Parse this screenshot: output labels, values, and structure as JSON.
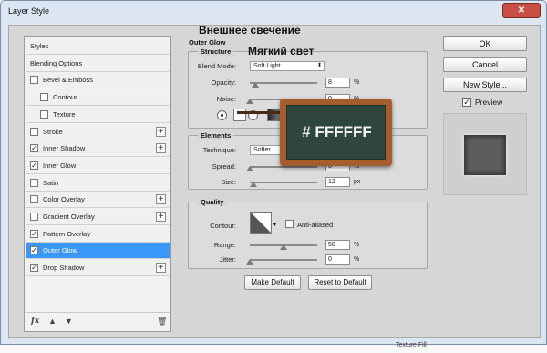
{
  "window": {
    "title": "Layer Style"
  },
  "styles_list": {
    "items": [
      {
        "label": "Styles",
        "checkbox": false,
        "checked": false,
        "indent": false,
        "plus": false,
        "selected": false
      },
      {
        "label": "Blending Options",
        "checkbox": false,
        "checked": false,
        "indent": false,
        "plus": false,
        "selected": false
      },
      {
        "label": "Bevel & Emboss",
        "checkbox": true,
        "checked": false,
        "indent": false,
        "plus": false,
        "selected": false
      },
      {
        "label": "Contour",
        "checkbox": true,
        "checked": false,
        "indent": true,
        "plus": false,
        "selected": false
      },
      {
        "label": "Texture",
        "checkbox": true,
        "checked": false,
        "indent": true,
        "plus": false,
        "selected": false
      },
      {
        "label": "Stroke",
        "checkbox": true,
        "checked": false,
        "indent": false,
        "plus": true,
        "selected": false
      },
      {
        "label": "Inner Shadow",
        "checkbox": true,
        "checked": true,
        "indent": false,
        "plus": true,
        "selected": false
      },
      {
        "label": "Inner Glow",
        "checkbox": true,
        "checked": true,
        "indent": false,
        "plus": false,
        "selected": false
      },
      {
        "label": "Satin",
        "checkbox": true,
        "checked": false,
        "indent": false,
        "plus": false,
        "selected": false
      },
      {
        "label": "Color Overlay",
        "checkbox": true,
        "checked": false,
        "indent": false,
        "plus": true,
        "selected": false
      },
      {
        "label": "Gradient Overlay",
        "checkbox": true,
        "checked": false,
        "indent": false,
        "plus": true,
        "selected": false
      },
      {
        "label": "Pattern Overlay",
        "checkbox": true,
        "checked": true,
        "indent": false,
        "plus": false,
        "selected": false
      },
      {
        "label": "Outer Glow",
        "checkbox": true,
        "checked": true,
        "indent": false,
        "plus": false,
        "selected": true
      },
      {
        "label": "Drop Shadow",
        "checkbox": true,
        "checked": true,
        "indent": false,
        "plus": true,
        "selected": false
      }
    ],
    "footer_icons": [
      "fx-icon",
      "move-up-icon",
      "move-down-icon",
      "trash-icon"
    ],
    "fx_label": "fx"
  },
  "outer_glow": {
    "header": "Outer Glow",
    "structure_title": "Structure",
    "blend_mode_label": "Blend Mode:",
    "blend_mode_value": "Soft Light",
    "opacity_label": "Opacity:",
    "opacity_value": "8",
    "opacity_fraction": 0.08,
    "noise_label": "Noise:",
    "noise_value": "0",
    "noise_fraction": 0.0,
    "elements_title": "Elements",
    "technique_label": "Technique:",
    "technique_value": "Softer",
    "spread_label": "Spread:",
    "spread_value": "0",
    "spread_fraction": 0.0,
    "size_label": "Size:",
    "size_value": "12",
    "size_fraction": 0.05,
    "quality_title": "Quality",
    "contour_label": "Contour:",
    "anti_aliased_label": "Anti-aliased",
    "range_label": "Range:",
    "range_value": "50",
    "range_fraction": 0.5,
    "jitter_label": "Jitter:",
    "jitter_value": "0",
    "jitter_fraction": 0.0,
    "percent_unit": "%",
    "px_unit": "px",
    "make_default_label": "Make Default",
    "reset_default_label": "Reset to Default"
  },
  "right_panel": {
    "ok_label": "OK",
    "cancel_label": "Cancel",
    "new_style_label": "New Style...",
    "preview_label": "Preview",
    "preview_checked": true
  },
  "annotations": {
    "outer_glow_ru": "Внешнее свечение",
    "soft_light_ru": "Мягкий свет",
    "color_sign": "# FFFFFF"
  },
  "colors": {
    "selected_row": "#3a97f7",
    "sign_frame": "#a65d2c",
    "sign_board": "#2e463c",
    "glow_color": "#FFFFFF"
  },
  "bottom_peek": {
    "label": "Texture Fill"
  }
}
